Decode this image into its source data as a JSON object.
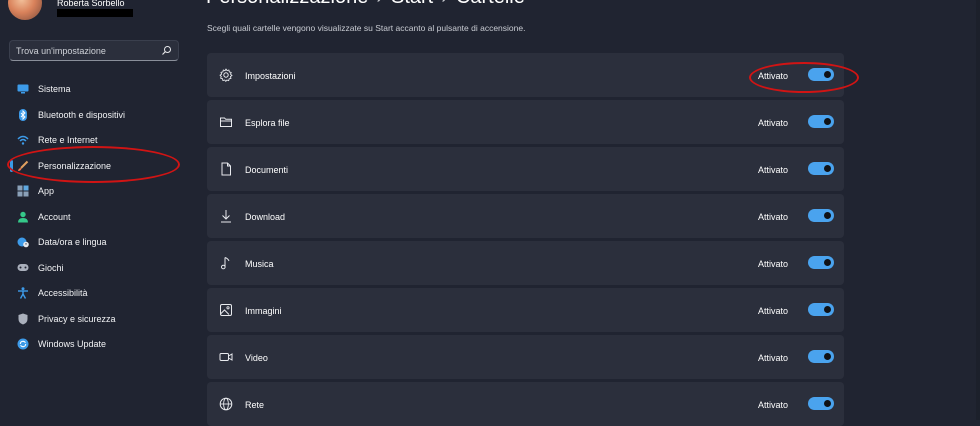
{
  "user": {
    "name": "Roberta Sorbello"
  },
  "search": {
    "placeholder": "Trova un'impostazione",
    "icon": "search-icon"
  },
  "sidebar": {
    "items": [
      {
        "label": "Sistema",
        "icon": "monitor-icon",
        "color": "#3d9be9"
      },
      {
        "label": "Bluetooth e dispositivi",
        "icon": "bluetooth-icon",
        "color": "#3d9be9"
      },
      {
        "label": "Rete e Internet",
        "icon": "wifi-icon",
        "color": "#3d9be9"
      },
      {
        "label": "Personalizzazione",
        "icon": "brush-icon",
        "color": "#e0a060",
        "active": true
      },
      {
        "label": "App",
        "icon": "apps-icon",
        "color": "#8aa0b8"
      },
      {
        "label": "Account",
        "icon": "person-icon",
        "color": "#35c98a"
      },
      {
        "label": "Data/ora e lingua",
        "icon": "globe-clock-icon",
        "color": "#3d9be9"
      },
      {
        "label": "Giochi",
        "icon": "gamepad-icon",
        "color": "#aab0bc"
      },
      {
        "label": "Accessibilità",
        "icon": "accessibility-icon",
        "color": "#3d9be9"
      },
      {
        "label": "Privacy e sicurezza",
        "icon": "shield-icon",
        "color": "#aab0bc"
      },
      {
        "label": "Windows Update",
        "icon": "update-icon",
        "color": "#3d9be9"
      }
    ]
  },
  "header": {
    "breadcrumb": [
      "Personalizzazione",
      "Start",
      "Cartelle"
    ],
    "separator": "›"
  },
  "description": "Scegli quali cartelle vengono visualizzate su Start accanto al pulsante di accensione.",
  "folders": [
    {
      "label": "Impostazioni",
      "icon": "gear-icon",
      "state": "Attivato",
      "on": true
    },
    {
      "label": "Esplora file",
      "icon": "folder-icon",
      "state": "Attivato",
      "on": true
    },
    {
      "label": "Documenti",
      "icon": "document-icon",
      "state": "Attivato",
      "on": true
    },
    {
      "label": "Download",
      "icon": "download-icon",
      "state": "Attivato",
      "on": true
    },
    {
      "label": "Musica",
      "icon": "music-icon",
      "state": "Attivato",
      "on": true
    },
    {
      "label": "Immagini",
      "icon": "image-icon",
      "state": "Attivato",
      "on": true
    },
    {
      "label": "Video",
      "icon": "video-icon",
      "state": "Attivato",
      "on": true
    },
    {
      "label": "Rete",
      "icon": "network-globe-icon",
      "state": "Attivato",
      "on": true
    }
  ],
  "colors": {
    "accent": "#4aa3ee",
    "annotation": "#d11414",
    "background": "#202431",
    "card": "#2b2f3c"
  }
}
